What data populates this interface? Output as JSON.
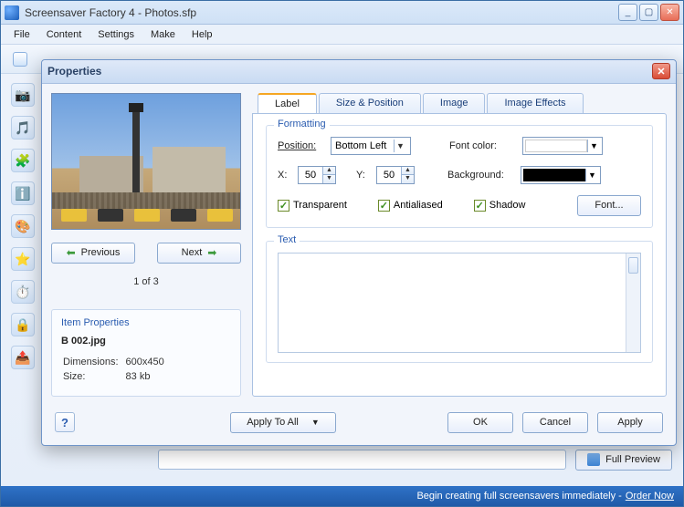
{
  "app": {
    "title": "Screensaver Factory 4 - Photos.sfp"
  },
  "menu": [
    "File",
    "Content",
    "Settings",
    "Make",
    "Help"
  ],
  "status": {
    "text": "Begin creating full screensavers immediately -",
    "link": "Order Now"
  },
  "full_preview_label": "Full Preview",
  "dialog": {
    "title": "Properties",
    "nav": {
      "prev": "Previous",
      "next": "Next",
      "counter": "1 of 3"
    },
    "item_properties": {
      "header": "Item Properties",
      "filename": "B 002.jpg",
      "rows": [
        {
          "k": "Dimensions:",
          "v": "600x450"
        },
        {
          "k": "Size:",
          "v": "83 kb"
        }
      ]
    },
    "tabs": [
      "Label",
      "Size & Position",
      "Image",
      "Image Effects"
    ],
    "active_tab": 0,
    "formatting": {
      "legend": "Formatting",
      "position_label": "Position:",
      "position_value": "Bottom Left",
      "x_label": "X:",
      "x_value": "50",
      "y_label": "Y:",
      "y_value": "50",
      "fontcolor_label": "Font color:",
      "fontcolor_value": "#ffffff",
      "background_label": "Background:",
      "background_value": "#000000",
      "transparent": "Transparent",
      "antialiased": "Antialiased",
      "shadow": "Shadow",
      "font_btn": "Font..."
    },
    "text_legend": "Text",
    "footer": {
      "apply_all": "Apply To All",
      "ok": "OK",
      "cancel": "Cancel",
      "apply": "Apply"
    }
  }
}
